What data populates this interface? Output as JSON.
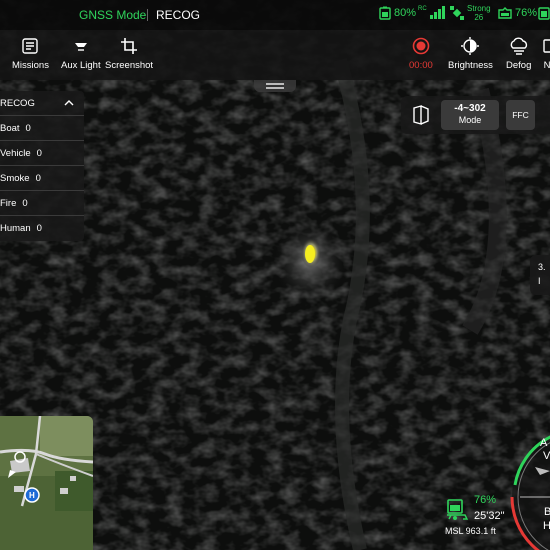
{
  "status_bar": {
    "gnss_mode": "GNSS Mode",
    "mode": "RECOG",
    "rc_battery": "80%",
    "signal_label": "RC",
    "gps_strength": "Strong",
    "gps_count": "26",
    "aircraft_battery": "76%",
    "colors": {
      "accent_green": "#2fd45b"
    }
  },
  "toolbar": {
    "items_left": [
      {
        "label": "Missions",
        "icon": "missions-icon"
      },
      {
        "label": "Aux Light",
        "icon": "aux-light-icon"
      },
      {
        "label": "Screenshot",
        "icon": "screenshot-icon"
      }
    ],
    "record_time": "00:00",
    "record_icon": "record-icon",
    "items_right": [
      {
        "label": "Brightness",
        "icon": "brightness-icon"
      },
      {
        "label": "Defog",
        "icon": "defog-icon"
      },
      {
        "label": "N",
        "icon": "more-icon"
      }
    ],
    "colors": {
      "record_red": "#e53935"
    }
  },
  "recog_panel": {
    "title": "RECOG",
    "rows": [
      {
        "label": "Boat",
        "count": "0"
      },
      {
        "label": "Vehicle",
        "count": "0"
      },
      {
        "label": "Smoke",
        "count": "0"
      },
      {
        "label": "Fire",
        "count": "0"
      },
      {
        "label": "Human",
        "count": "0"
      }
    ]
  },
  "camera_controls": {
    "mode_value": "-4~302",
    "mode_label": "Mode",
    "ffc_label": "FFC",
    "palette_icon": "palette-icon"
  },
  "side_readout": {
    "line1": "3.",
    "line2": "I"
  },
  "battery": {
    "percent": "76%",
    "flight_time": "25'32\"",
    "msl": "MSL 963.1 ft"
  },
  "attitude": {
    "a": "A",
    "v": "V",
    "b": "B",
    "h": "H"
  }
}
